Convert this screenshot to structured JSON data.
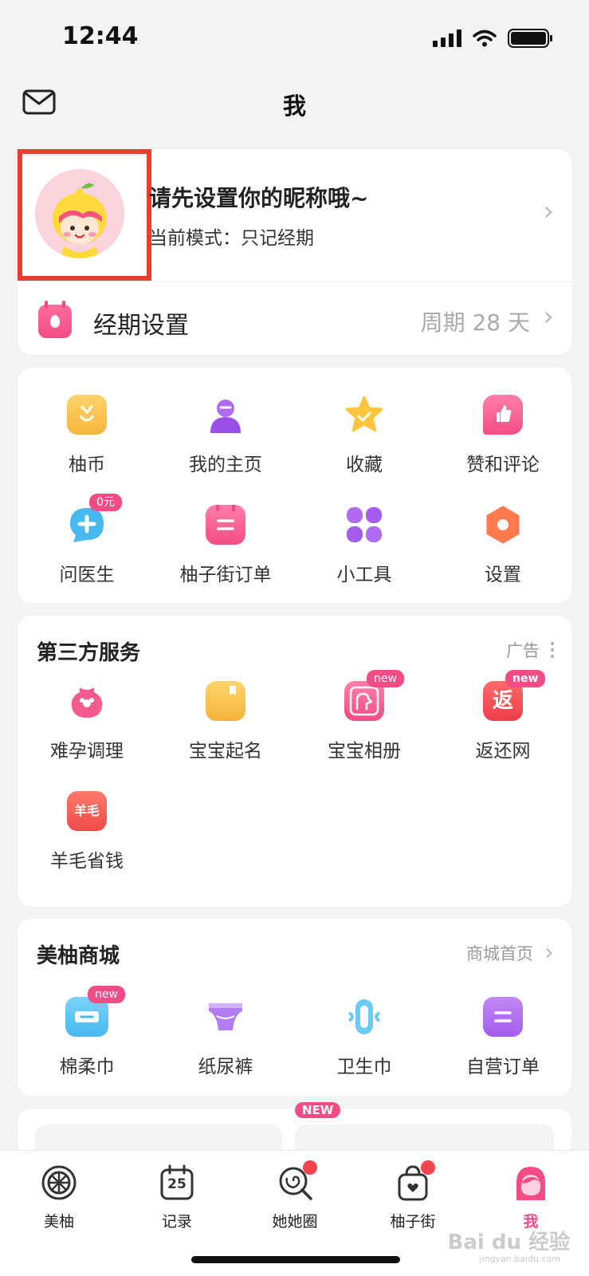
{
  "status_bar": {
    "time": "12:44"
  },
  "nav": {
    "title": "我"
  },
  "profile": {
    "nickname_prompt": "请先设置你的昵称哦~",
    "mode_text": "当前模式：只记经期",
    "period_label": "经期设置",
    "period_value": "周期 28 天"
  },
  "quick_grid": [
    {
      "label": "柚币",
      "icon": "coin-icon"
    },
    {
      "label": "我的主页",
      "icon": "person-icon"
    },
    {
      "label": "收藏",
      "icon": "star-icon"
    },
    {
      "label": "赞和评论",
      "icon": "thumb-up-icon"
    },
    {
      "label": "问医生",
      "icon": "doctor-chat-icon",
      "badge": "0元"
    },
    {
      "label": "柚子街订单",
      "icon": "order-icon"
    },
    {
      "label": "小工具",
      "icon": "tools-icon"
    },
    {
      "label": "设置",
      "icon": "settings-icon"
    }
  ],
  "third_party": {
    "title": "第三方服务",
    "ad_label": "广告",
    "items": [
      {
        "label": "难孕调理",
        "icon": "fertility-icon"
      },
      {
        "label": "宝宝起名",
        "icon": "naming-book-icon"
      },
      {
        "label": "宝宝相册",
        "icon": "baby-album-icon",
        "badge": "new"
      },
      {
        "label": "返还网",
        "icon": "cashback-icon",
        "badge": "new",
        "glyph": "返"
      },
      {
        "label": "羊毛省钱",
        "icon": "savings-icon",
        "glyph": "羊毛"
      }
    ]
  },
  "mall": {
    "title": "美柚商城",
    "link": "商城首页",
    "items": [
      {
        "label": "棉柔巾",
        "icon": "cotton-towel-icon",
        "badge": "new"
      },
      {
        "label": "纸尿裤",
        "icon": "diaper-icon"
      },
      {
        "label": "卫生巾",
        "icon": "sanitary-pad-icon"
      },
      {
        "label": "自营订单",
        "icon": "self-order-icon"
      }
    ]
  },
  "promo": {
    "tag": "NEW"
  },
  "tabs": [
    {
      "label": "美柚",
      "icon": "meiyou-icon"
    },
    {
      "label": "记录",
      "icon": "calendar-icon",
      "glyph": "25"
    },
    {
      "label": "她她圈",
      "icon": "lollipop-icon",
      "dot": true
    },
    {
      "label": "柚子街",
      "icon": "shopping-bag-icon",
      "dot": true
    },
    {
      "label": "我",
      "icon": "me-icon",
      "active": true
    }
  ],
  "watermark": {
    "text": "Bai du 经验",
    "sub": "jingyan.baidu.com"
  },
  "colors": {
    "accent": "#f24c86",
    "highlight_border": "#ec3b2f"
  }
}
